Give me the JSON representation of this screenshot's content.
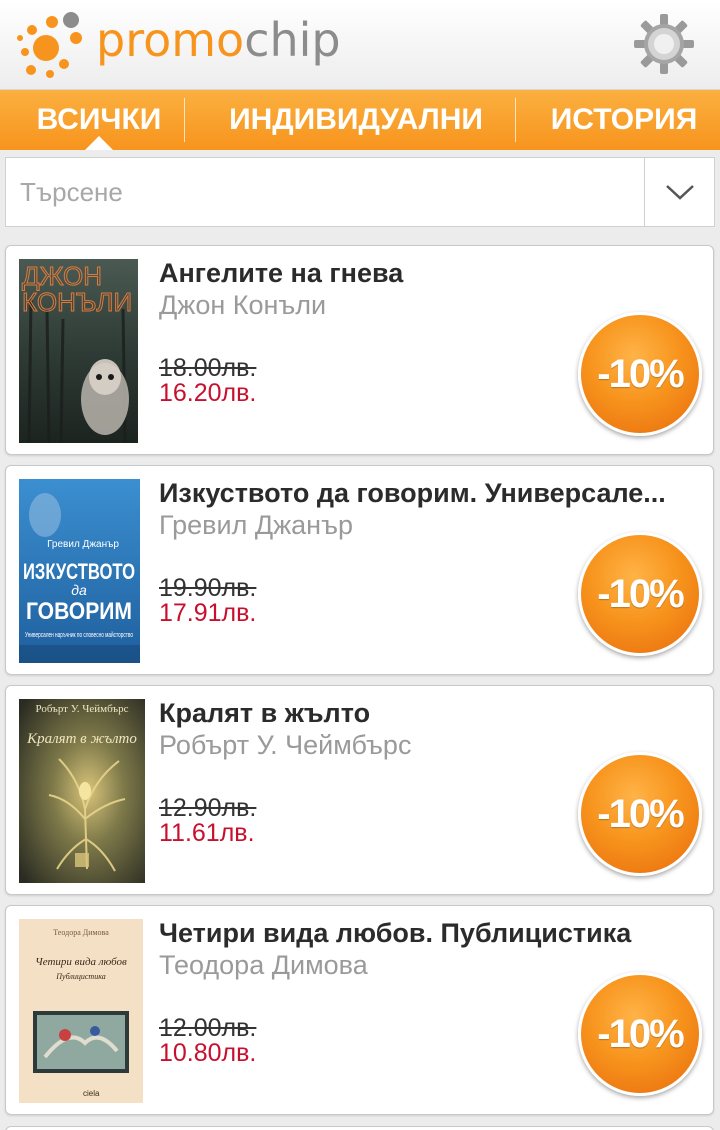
{
  "app": {
    "logo_part1": "promo",
    "logo_part2": "chip",
    "brand_color": "#f7941d"
  },
  "tabs": [
    {
      "label": "ВСИЧКИ",
      "selected": true
    },
    {
      "label": "ИНДИВИДУАЛНИ",
      "selected": false
    },
    {
      "label": "ИСТОРИЯ",
      "selected": false
    }
  ],
  "search": {
    "placeholder": "Търсене",
    "value": ""
  },
  "books": [
    {
      "title": "Ангелите на гнева",
      "author": "Джон Конъли",
      "old_price": "18.00лв.",
      "new_price": "16.20лв.",
      "discount": "-10%",
      "cover_text": "ДЖОН КОНЪЛИ"
    },
    {
      "title": "Изкуството да говорим. Универсале...",
      "author": "Гревил Джанър",
      "old_price": "19.90лв.",
      "new_price": "17.91лв.",
      "discount": "-10%",
      "cover_author": "Гревил Джанър",
      "cover_title1": "ИЗКУСТВОТО",
      "cover_title2": "да",
      "cover_title3": "ГОВОРИМ",
      "cover_sub": "Универсален наръчник по словесно майсторство"
    },
    {
      "title": "Кралят в жълто",
      "author": "Робърт У. Чеймбърс",
      "old_price": "12.90лв.",
      "new_price": "11.61лв.",
      "discount": "-10%",
      "cover_author": "Робърт У. Чеймбърс",
      "cover_title": "Кралят в жълто"
    },
    {
      "title": "Четири вида любов. Публицистика",
      "author": "Теодора Димова",
      "old_price": "12.00лв.",
      "new_price": "10.80лв.",
      "discount": "-10%",
      "cover_author": "Теодора Димова",
      "cover_title": "Четири вида любов",
      "cover_sub": "Публицистика",
      "cover_publisher": "ciela"
    }
  ],
  "colors": {
    "price_new": "#c8102e",
    "badge": "#f7941d",
    "tab_bar": "#f7941d"
  }
}
